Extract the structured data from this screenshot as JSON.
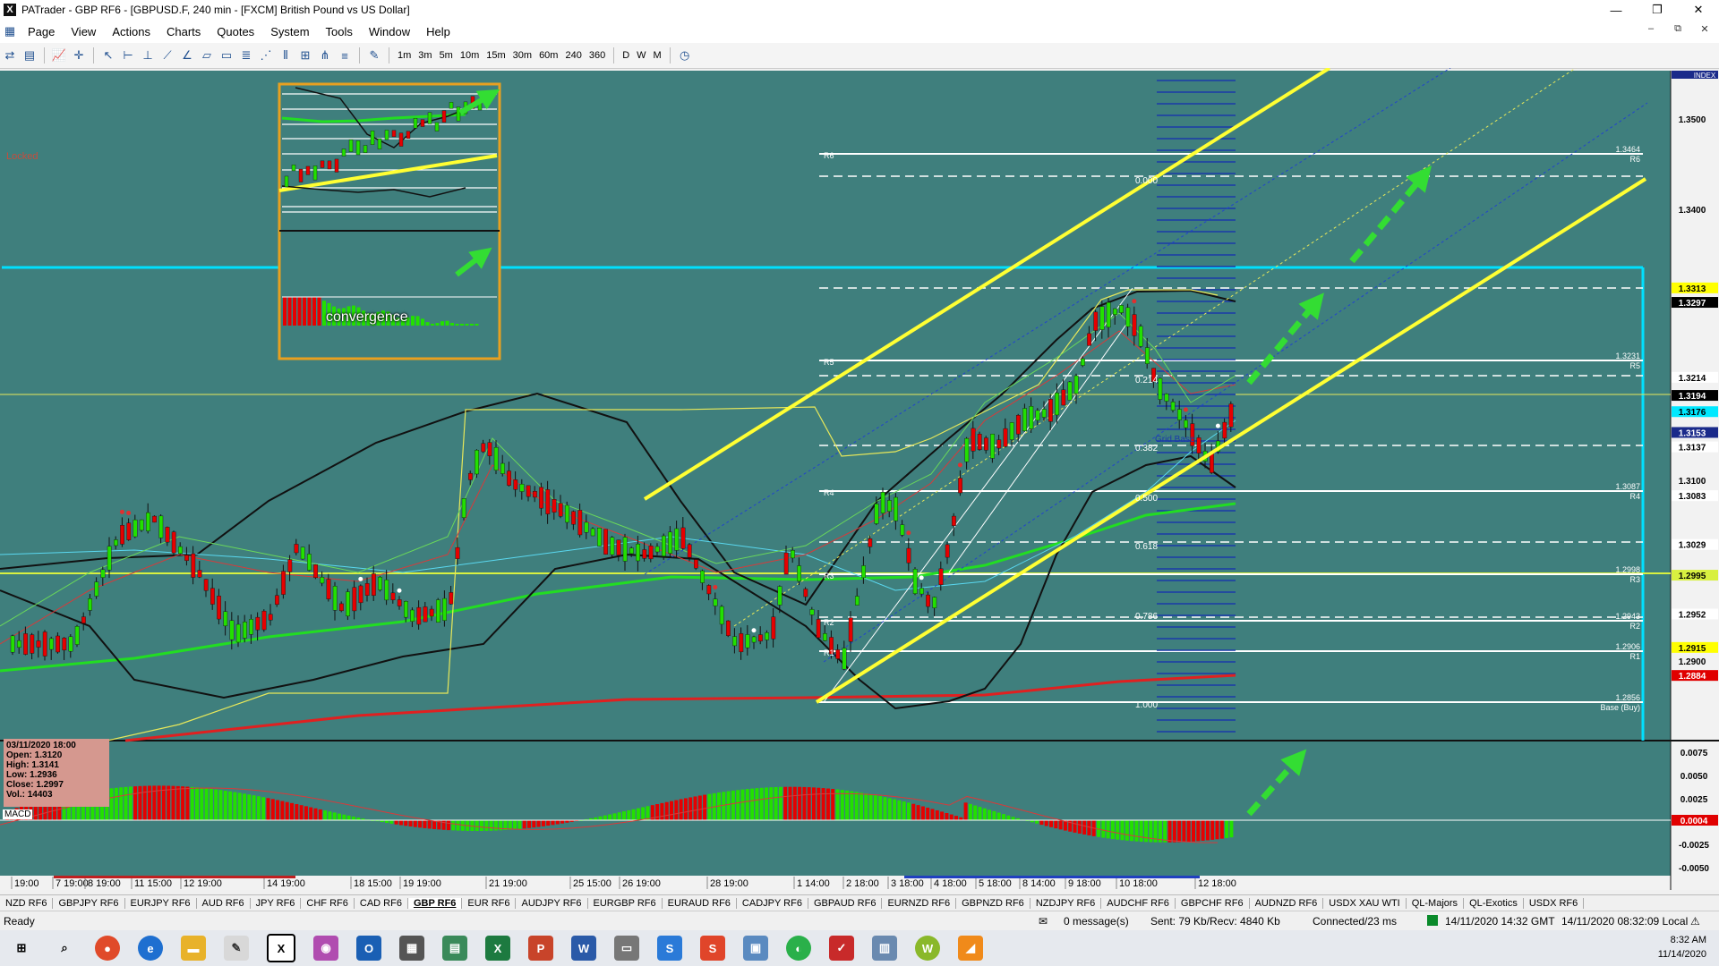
{
  "window": {
    "title": "PATrader - GBP RF6 - [GBPUSD.F, 240 min - [FXCM] British Pound vs US Dollar]",
    "icon": "x-logo-icon",
    "minimize": "—",
    "maximize": "❐",
    "close": "✕"
  },
  "menu": {
    "items": [
      "Page",
      "View",
      "Actions",
      "Charts",
      "Quotes",
      "System",
      "Tools",
      "Window",
      "Help"
    ],
    "mdi": [
      "–",
      "⧉",
      "✕"
    ]
  },
  "toolbar": {
    "timeframes": [
      "1m",
      "3m",
      "5m",
      "10m",
      "15m",
      "30m",
      "60m",
      "240",
      "360"
    ],
    "periods": [
      "D",
      "W",
      "M"
    ]
  },
  "chart": {
    "locked_label": "Locked",
    "index_label": "INDEX",
    "price_labels": [
      {
        "text": "1.3500",
        "style": "plain",
        "price": 1.35
      },
      {
        "text": "1.3400",
        "style": "plain",
        "price": 1.34
      },
      {
        "text": "1.3313",
        "style": "yellow",
        "price": 1.3313
      },
      {
        "text": "1.3297",
        "style": "black",
        "price": 1.3297
      },
      {
        "text": "1.3214",
        "style": "white",
        "price": 1.3214
      },
      {
        "text": "1.3194",
        "style": "black",
        "price": 1.3194
      },
      {
        "text": "1.3176",
        "style": "cyan",
        "price": 1.3176
      },
      {
        "text": "1.3153",
        "style": "navy",
        "price": 1.3153
      },
      {
        "text": "1.3137",
        "style": "white",
        "price": 1.3137
      },
      {
        "text": "1.3100",
        "style": "plain",
        "price": 1.31
      },
      {
        "text": "1.3083",
        "style": "white",
        "price": 1.3083
      },
      {
        "text": "1.3029",
        "style": "white",
        "price": 1.3029
      },
      {
        "text": "1.2995",
        "style": "yellowgreen",
        "price": 1.2995
      },
      {
        "text": "1.2952",
        "style": "white",
        "price": 1.2952
      },
      {
        "text": "1.2915",
        "style": "yellow",
        "price": 1.2915
      },
      {
        "text": "1.2900",
        "style": "plain",
        "price": 1.29
      },
      {
        "text": "1.2884",
        "style": "red",
        "price": 1.2884
      }
    ],
    "pivots": [
      {
        "name": "R6",
        "value": "1.3464"
      },
      {
        "name": "R5",
        "value": "1.3231"
      },
      {
        "name": "R4",
        "value": "1.3087"
      },
      {
        "name": "R3",
        "value": "1.2998"
      },
      {
        "name": "R2",
        "value": "1.2943"
      },
      {
        "name": "R1",
        "value": "1.2906"
      },
      {
        "name": "Base (Buy)",
        "value": "1.2856"
      }
    ],
    "fib_labels": [
      "0.000",
      "0.214",
      "0.382",
      "0.500",
      "0.618",
      "0.786",
      "1.000"
    ],
    "grid_base_label": "Grid Base",
    "info_box": {
      "date": "03/11/2020 18:00",
      "open": "Open: 1.3120",
      "high": "High: 1.3141",
      "low": "Low: 1.2936",
      "close": "Close: 1.2997",
      "vol": "Vol.: 14403"
    },
    "inset_label": "convergence",
    "macd_label": "MACD",
    "macd_axis": [
      {
        "text": "0.0075",
        "style": "plain"
      },
      {
        "text": "0.0050",
        "style": "plain"
      },
      {
        "text": "0.0025",
        "style": "plain"
      },
      {
        "text": "0.0004",
        "style": "red"
      },
      {
        "text": "-0.0025",
        "style": "plain"
      },
      {
        "text": "-0.0050",
        "style": "plain"
      }
    ],
    "time_labels": [
      "19:00",
      "7 19:00",
      "8 19:00",
      "11 15:00",
      "12 19:00",
      "14 19:00",
      "18 15:00",
      "19 19:00",
      "21 19:00",
      "25 15:00",
      "26 19:00",
      "28 19:00",
      "1 14:00",
      "2 18:00",
      "3 18:00",
      "4 18:00",
      "5 18:00",
      "8 14:00",
      "9 18:00",
      "10 18:00",
      "12 18:00"
    ],
    "colors": {
      "background": "#3f7f7d",
      "bull": "#22e000",
      "bear": "#e60000",
      "channel": "#ffff33",
      "arrows": "#33dd33",
      "cyan_level": "#00e0ff"
    }
  },
  "symbol_tabs": {
    "items": [
      "NZD RF6",
      "GBPJPY RF6",
      "EURJPY RF6",
      "AUD RF6",
      "JPY RF6",
      "CHF RF6",
      "CAD RF6",
      "GBP RF6",
      "EUR RF6",
      "AUDJPY RF6",
      "EURGBP RF6",
      "EURAUD RF6",
      "CADJPY RF6",
      "GBPAUD RF6",
      "EURNZD RF6",
      "GBPNZD RF6",
      "NZDJPY RF6",
      "AUDCHF RF6",
      "GBPCHF RF6",
      "AUDNZD RF6",
      "USDX XAU WTI",
      "QL-Majors",
      "QL-Exotics",
      "USDX RF6"
    ],
    "active": "GBP RF6"
  },
  "status": {
    "ready": "Ready",
    "messages": "0 message(s)",
    "traffic": "Sent: 79 Kb/Recv: 4840 Kb",
    "connection": "Connected/23 ms",
    "gmt": "14/11/2020 14:32 GMT",
    "local": "14/11/2020 08:32:09 Local"
  },
  "taskbar": {
    "time": "8:32 AM",
    "date": "11/14/2020"
  }
}
